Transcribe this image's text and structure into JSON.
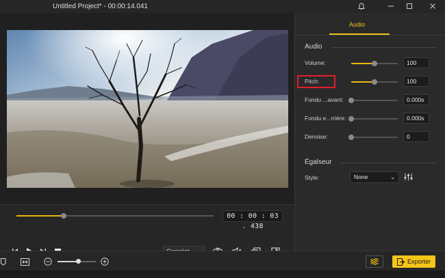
{
  "window": {
    "title": "Untitled Project* - 00:00:14.041"
  },
  "player": {
    "timecode": "00 : 00 : 03 . 438",
    "progress": 0.24,
    "quality": "Complet"
  },
  "panel": {
    "tab": "Audio",
    "audio_section": "Audio",
    "params": [
      {
        "label": "Volume:",
        "value": "100",
        "level": 0.5
      },
      {
        "label": "Pitch:",
        "value": "100",
        "level": 0.5
      },
      {
        "label": "Fondu ...avant:",
        "value": "0.000s",
        "level": 0.0
      },
      {
        "label": "Fondu e...rrière:",
        "value": "0.000s",
        "level": 0.0
      },
      {
        "label": "Denoise:",
        "value": "0",
        "level": 0.0
      }
    ],
    "eq_section": "Égalseur",
    "style_label": "Style:",
    "style_value": "None"
  },
  "bottom": {
    "zoom": 0.55,
    "export_label": "Exporter"
  },
  "colors": {
    "accent": "#f0c020",
    "highlight": "#e0202a"
  }
}
